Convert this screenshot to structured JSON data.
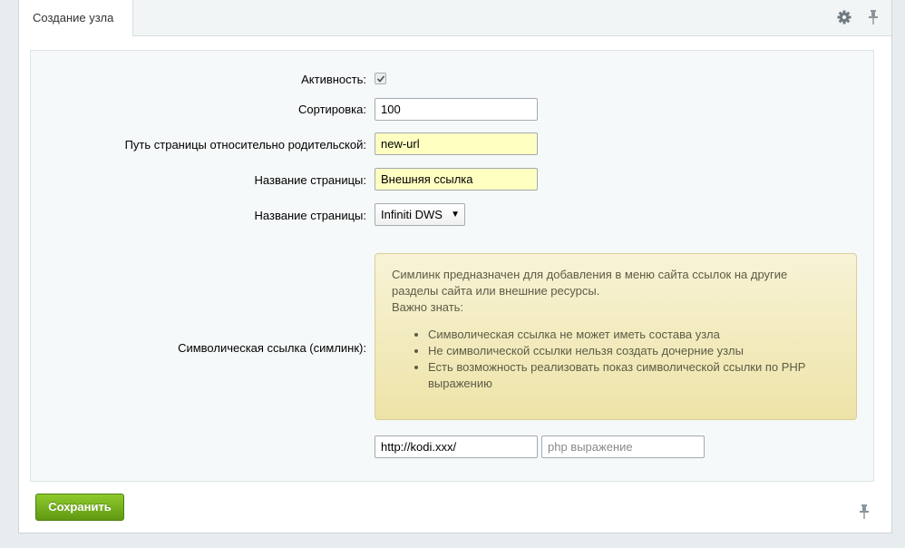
{
  "tab": {
    "title": "Создание узла"
  },
  "icons": {
    "settings": "gear-icon",
    "pin": "pin-icon"
  },
  "form": {
    "active_label": "Активность:",
    "active_checked": true,
    "sort_label": "Сортировка:",
    "sort_value": "100",
    "path_label": "Путь страницы относительно родительской:",
    "path_value": "new-url",
    "page_name_label": "Название страницы:",
    "page_name_value": "Внешняя ссылка",
    "page_select_label": "Название страницы:",
    "page_select_value": "Infiniti DWS",
    "symlink_label": "Символическая ссылка (симлинк):",
    "notice": {
      "line1": "Симлинк предназначен для добавления в меню сайта ссылок на другие",
      "line2": "разделы сайта или внешние ресурсы.",
      "line3": "Важно знать:",
      "items": [
        "Символическая ссылка не может иметь состава узла",
        "Не символической ссылки нельзя создать дочерние узлы",
        "Есть возможность реализовать показ символической ссылки по PHP выражению"
      ]
    },
    "url_value": "http://kodi.xxx/",
    "php_placeholder": "php выражение"
  },
  "buttons": {
    "save": "Сохранить"
  },
  "colors": {
    "save_green": "#6aa81a",
    "notice_bg": "#f3ecc0",
    "highlight_input": "#ffffc2"
  }
}
